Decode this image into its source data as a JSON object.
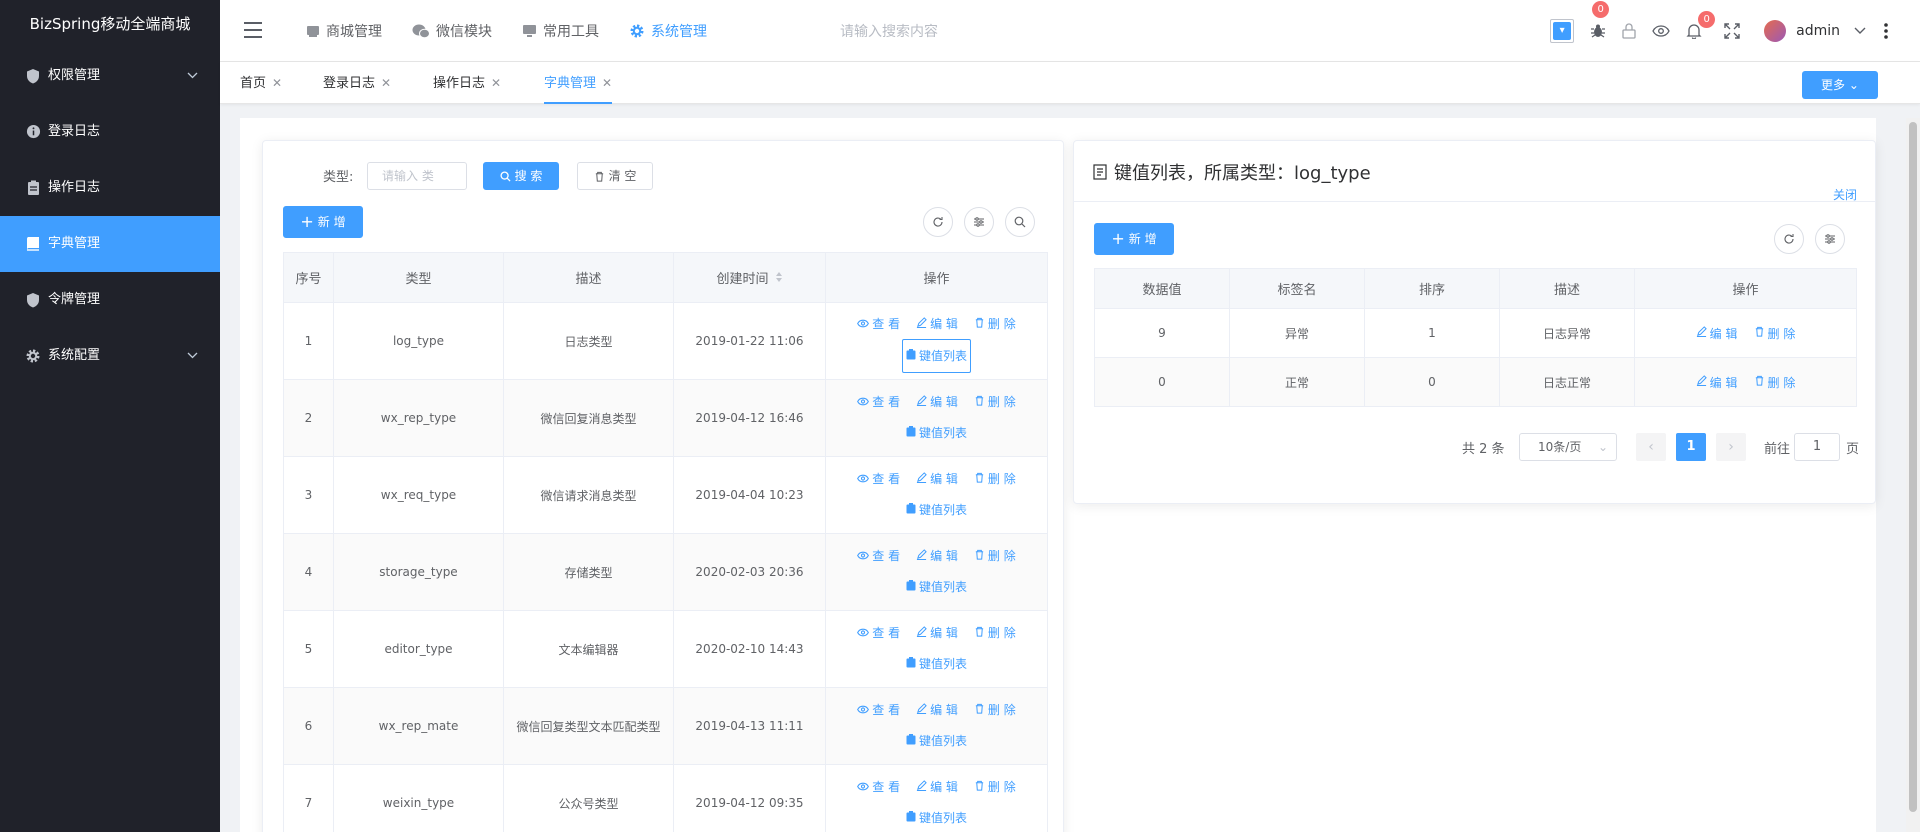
{
  "app": {
    "title": "BizSpring移动全端商城"
  },
  "sidebar": {
    "items": [
      {
        "label": "权限管理",
        "icon": "shield-icon",
        "has_children": true,
        "active": false
      },
      {
        "label": "登录日志",
        "icon": "info-icon",
        "has_children": false,
        "active": false
      },
      {
        "label": "操作日志",
        "icon": "clipboard-icon",
        "has_children": false,
        "active": false
      },
      {
        "label": "字典管理",
        "icon": "book-icon",
        "has_children": false,
        "active": true
      },
      {
        "label": "令牌管理",
        "icon": "shield-icon",
        "has_children": false,
        "active": false
      },
      {
        "label": "系统配置",
        "icon": "gear-icon",
        "has_children": true,
        "active": false
      }
    ]
  },
  "header": {
    "nav": [
      {
        "label": "商城管理",
        "icon": "shop-icon",
        "active": false
      },
      {
        "label": "微信模块",
        "icon": "wechat-icon",
        "active": false
      },
      {
        "label": "常用工具",
        "icon": "monitor-icon",
        "active": false
      },
      {
        "label": "系统管理",
        "icon": "gear-icon",
        "active": true
      }
    ],
    "search_placeholder": "请输入搜索内容",
    "bug_badge": "0",
    "bell_badge": "0",
    "username": "admin"
  },
  "tabs": [
    {
      "label": "首页",
      "active": false
    },
    {
      "label": "登录日志",
      "active": false
    },
    {
      "label": "操作日志",
      "active": false
    },
    {
      "label": "字典管理",
      "active": true
    }
  ],
  "more_button": "更多",
  "left_panel": {
    "filter_label": "类型:",
    "filter_placeholder": "请输入 类",
    "search_button": "搜 索",
    "clear_button": "清 空",
    "add_button": "新 增",
    "columns": [
      "序号",
      "类型",
      "描述",
      "创建时间",
      "操作"
    ],
    "rows": [
      {
        "index": "1",
        "type": "log_type",
        "desc": "日志类型",
        "created": "2019-01-22 11:06"
      },
      {
        "index": "2",
        "type": "wx_rep_type",
        "desc": "微信回复消息类型",
        "created": "2019-04-12 16:46"
      },
      {
        "index": "3",
        "type": "wx_req_type",
        "desc": "微信请求消息类型",
        "created": "2019-04-04 10:23"
      },
      {
        "index": "4",
        "type": "storage_type",
        "desc": "存储类型",
        "created": "2020-02-03 20:36"
      },
      {
        "index": "5",
        "type": "editor_type",
        "desc": "文本编辑器",
        "created": "2020-02-10 14:43"
      },
      {
        "index": "6",
        "type": "wx_rep_mate",
        "desc": "微信回复类型文本匹配类型",
        "created": "2019-04-13 11:11"
      },
      {
        "index": "7",
        "type": "weixin_type",
        "desc": "公众号类型",
        "created": "2019-04-12 09:35"
      }
    ],
    "actions": {
      "view": "查 看",
      "edit": "编 辑",
      "delete": "删 除",
      "kv_list": "键值列表"
    }
  },
  "right_panel": {
    "title": "键值列表，所属类型：log_type",
    "close": "关闭",
    "add_button": "新 增",
    "columns": [
      "数据值",
      "标签名",
      "排序",
      "描述",
      "操作"
    ],
    "rows": [
      {
        "value": "9",
        "label": "异常",
        "sort": "1",
        "desc": "日志异常"
      },
      {
        "value": "0",
        "label": "正常",
        "sort": "0",
        "desc": "日志正常"
      }
    ],
    "actions": {
      "edit": "编 辑",
      "delete": "删 除"
    },
    "pagination": {
      "total": "共 2 条",
      "page_size": "10条/页",
      "current": "1",
      "goto_label": "前往",
      "goto_value": "1",
      "page_unit": "页"
    }
  },
  "colors": {
    "primary": "#409eff",
    "sidebar_bg": "#20222a",
    "danger": "#f56c6c"
  }
}
